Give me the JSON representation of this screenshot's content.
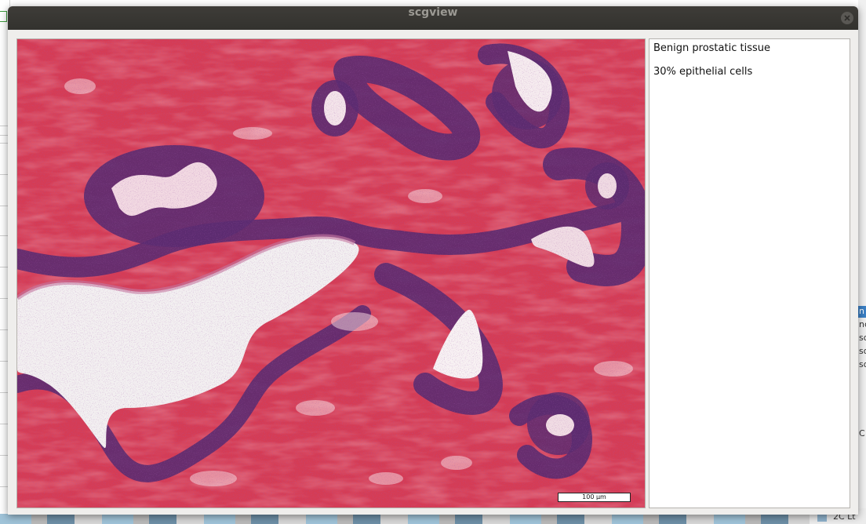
{
  "window": {
    "title": "scgview"
  },
  "image": {
    "scale_label": "100 µm",
    "stain_colors": {
      "stroma": "#d33a52",
      "nuclei": "#5a2a6e",
      "lumen": "#f4ecef"
    }
  },
  "description": {
    "lines": [
      "Benign prostatic tissue",
      "30% epithelial cells"
    ]
  },
  "background": {
    "right_fragments": [
      "n",
      "nc",
      "so",
      "so",
      "so",
      "C"
    ],
    "bottom_right_text": "2C Lt"
  }
}
